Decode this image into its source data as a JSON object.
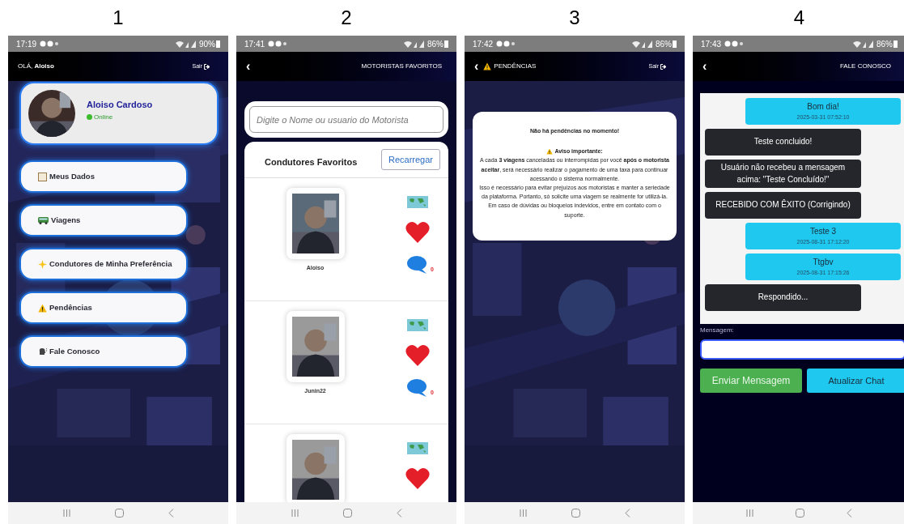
{
  "screens": [
    {
      "number": "1",
      "kind": "home",
      "status_bar": {
        "time": "17:19",
        "battery": "90%"
      },
      "background": {
        "kind": "picture"
      },
      "header": {
        "greeting": "OLÁ, **Aloiso**",
        "logout": "Sair"
      },
      "profile": {
        "avatar": {
          "kind": "picture"
        },
        "name": "Aloiso Cardoso",
        "status": "Online"
      },
      "menu": [
        {
          "kind": "clipboard",
          "label": "Meus Dados"
        },
        {
          "kind": "bus",
          "label": "Viagens"
        },
        {
          "kind": "star",
          "label": "Condutores de Minha Preferência"
        },
        {
          "kind": "warning",
          "label": "Pendências"
        },
        {
          "kind": "speaker",
          "label": "Fale Conosco"
        }
      ]
    },
    {
      "number": "2",
      "kind": "favorites",
      "status_bar": {
        "time": "17:41",
        "battery": "86%"
      },
      "header": {
        "back": "‹",
        "title": "MOTORISTAS FAVORITOS"
      },
      "search": {
        "placeholder": "Digite o Nome ou usuario do Motorista"
      },
      "list_title": "Condutores Favoritos",
      "reload_button": "Recarregar",
      "drivers": [
        {
          "photo": {
            "kind": "picture"
          },
          "name": "Aloiso",
          "count": "0"
        },
        {
          "photo": {
            "kind": "picture"
          },
          "name": "Junin22",
          "count": "0"
        },
        {
          "photo": {
            "kind": "picture"
          }
        }
      ]
    },
    {
      "number": "3",
      "kind": "pending",
      "status_bar": {
        "time": "17:42",
        "battery": "86%"
      },
      "background": {
        "kind": "picture"
      },
      "header": {
        "back": "‹",
        "title": "PENDÊNCIAS",
        "logout": "Sair"
      },
      "notice": {
        "heading": "Não há pendências no momento!",
        "warning_title": "Aviso importante:",
        "paragraphs": [
          "A cada **3 viagens** canceladas ou interrompidas por você **após o motorista aceitar**, será necessário realizar o pagamento de uma taxa para continuar acessando o sistema normalmente.",
          "Isso é necessário para evitar prejuízos aos motoristas e manter a seriedade da plataforma. Portanto, só solicite uma viagem se realmente for utilizá-la.",
          "Em caso de dúvidas ou bloqueios indevidos, entre em contato com o suporte."
        ]
      }
    },
    {
      "number": "4",
      "kind": "chat",
      "status_bar": {
        "time": "17:43",
        "battery": "86%"
      },
      "header": {
        "back": "‹",
        "title": "FALE CONOSCO"
      },
      "messages": [
        {
          "kind": "sent",
          "text": "Bom dia!",
          "time": "2025-03-31 07:52:10"
        },
        {
          "kind": "received",
          "text": "Teste concluido!"
        },
        {
          "kind": "received",
          "text": "Usuário não recebeu a mensagem acima: \"Teste Concluído!\""
        },
        {
          "kind": "received",
          "text": "RECEBIDO COM ÊXITO (Corrigindo)"
        },
        {
          "kind": "sent",
          "text": "Teste 3",
          "time": "2025-08-31 17:12:20"
        },
        {
          "kind": "sent",
          "text": "Ttgbv",
          "time": "2025-08-31 17:15:26"
        },
        {
          "kind": "received",
          "text": "Respondido..."
        }
      ],
      "message_label": "Mensagem:",
      "send_button": "Enviar Mensagem",
      "refresh_button": "Atualizar Chat"
    }
  ]
}
